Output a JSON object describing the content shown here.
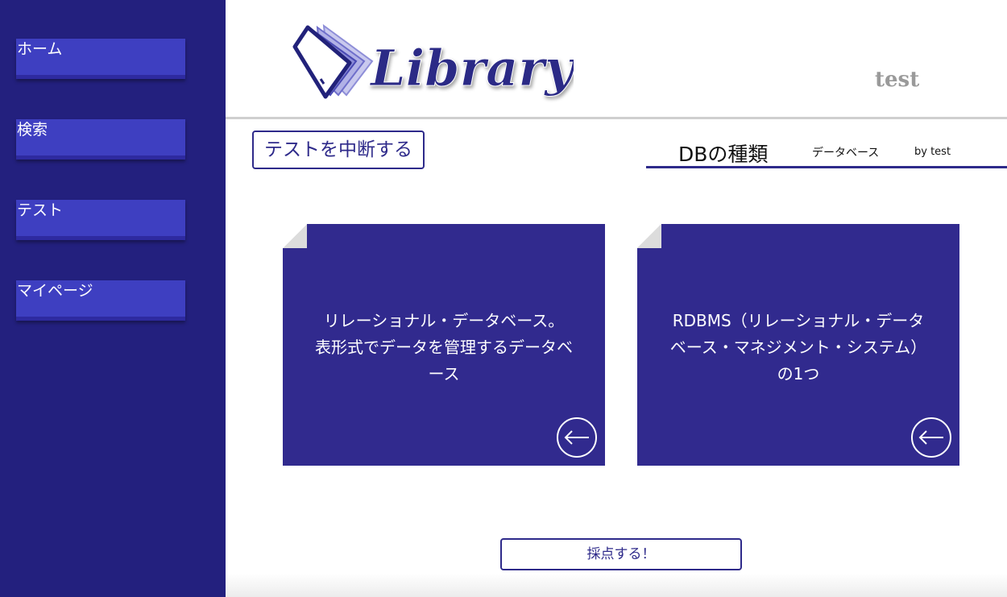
{
  "sidebar": {
    "items": [
      {
        "label": "ホーム"
      },
      {
        "label": "検索"
      },
      {
        "label": "テスト"
      },
      {
        "label": "マイページ"
      }
    ]
  },
  "header": {
    "logo_text": "Library",
    "username": "test"
  },
  "quiz": {
    "stop_button": "テストを中断する",
    "title": "DBの種類",
    "category": "データベース",
    "author": "by test",
    "submit_button": "採点する！"
  },
  "cards": [
    {
      "text": "リレーショナル・データベース。 表形式でデータを管理するデータベース"
    },
    {
      "text": "RDBMS（リレーショナル・データベース・マネジメント・システム）の1つ"
    }
  ],
  "colors": {
    "sidebar_bg": "#23207e",
    "nav_item_bg": "#3e3fc1",
    "card_bg": "#312a8e",
    "accent": "#2e2a8a"
  }
}
